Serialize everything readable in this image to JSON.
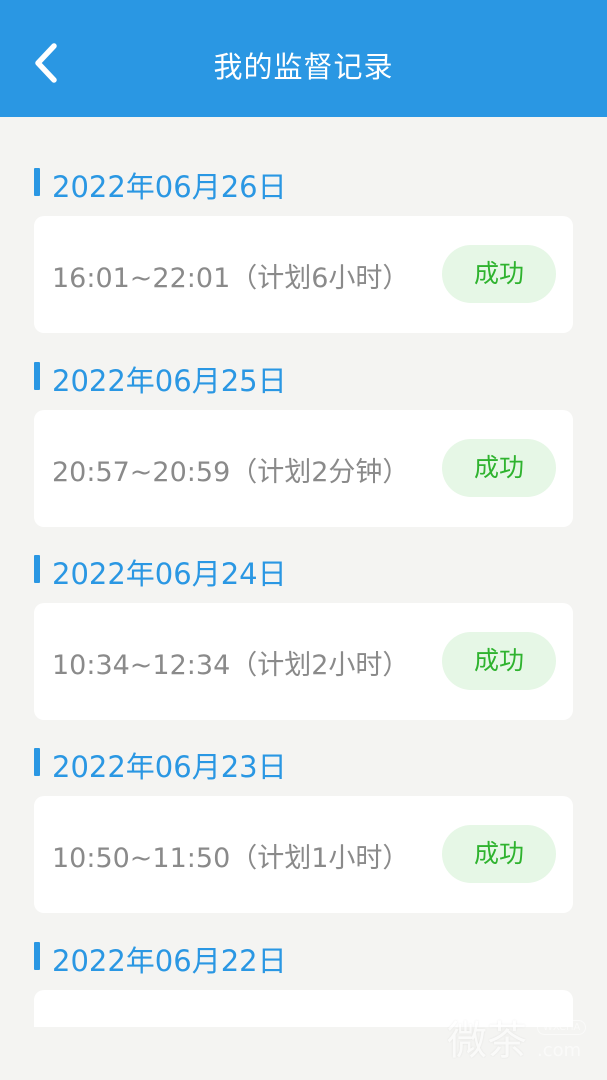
{
  "header": {
    "title": "我的监督记录",
    "back_icon": "chevron-left-icon"
  },
  "records": [
    {
      "date": "2022年06月26日",
      "detail": "16:01~22:01（计划6小时）",
      "status": "成功"
    },
    {
      "date": "2022年06月25日",
      "detail": "20:57~20:59（计划2分钟）",
      "status": "成功"
    },
    {
      "date": "2022年06月24日",
      "detail": "10:34~12:34（计划2小时）",
      "status": "成功"
    },
    {
      "date": "2022年06月23日",
      "detail": "10:50~11:50（计划1小时）",
      "status": "成功"
    },
    {
      "date": "2022年06月22日",
      "detail": "",
      "status": ""
    }
  ],
  "watermark": {
    "chars": "微茶",
    "tag": "WXCHA",
    "suffix": ".com"
  },
  "colors": {
    "accent": "#2a97e3",
    "background": "#f4f4f2",
    "status_text": "#2fb32f",
    "status_bg": "#e6f7e6",
    "detail_text": "#8a8a8a"
  }
}
